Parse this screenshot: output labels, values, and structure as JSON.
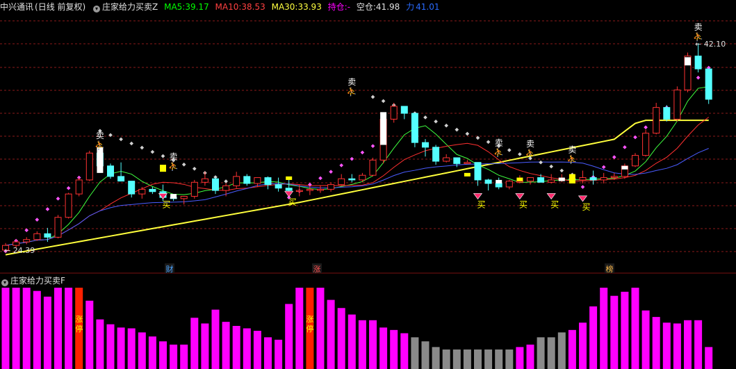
{
  "header": {
    "stock_name": "中兴通讯",
    "period": "(日线 前复权)",
    "indicator_name": "庄家给力买卖Z",
    "ma5_label": "MA5:",
    "ma5_value": "39.17",
    "ma10_label": "MA10:",
    "ma10_value": "38.53",
    "ma30_label": "MA30:",
    "ma30_value": "33.93",
    "position_label": "持仓:",
    "position_value": "-",
    "empty_label": "空仓:",
    "empty_value": "41.98",
    "force_label": "力",
    "force_value": "41.01"
  },
  "sub_header": {
    "indicator_name": "庄家给力买卖F"
  },
  "colors": {
    "up": "#ff3232",
    "down": "#54ffff",
    "ma5": "#ffffff",
    "ma10": "#ffff00",
    "ma30": "#ff00ff",
    "sell_dots": "#cfcfcf",
    "buy_dots": "#ff55ff",
    "base_line": "#ffff3c",
    "hist_magenta": "#ff00ff",
    "hist_gray": "#8a8a8a",
    "hist_red": "#ff2000",
    "grid": "#8b1a1a"
  },
  "price_labels": {
    "high": "42.10",
    "low": "24.39"
  },
  "event_markers": [
    "财",
    "涨",
    "榜"
  ],
  "signal_labels": {
    "buy": "买",
    "sell": "卖",
    "limit_up": "涨停"
  },
  "chart_data": [
    {
      "type": "candlestick",
      "title": "中兴通讯 (日线 前复权)",
      "x": [
        0,
        1,
        2,
        3,
        4,
        5,
        6,
        7,
        8,
        9,
        10,
        11,
        12,
        13,
        14,
        15,
        16,
        17,
        18,
        19,
        20,
        21,
        22,
        23,
        24,
        25,
        26,
        27,
        28,
        29,
        30,
        31,
        32,
        33,
        34,
        35,
        36,
        37,
        38,
        39,
        40,
        41,
        42,
        43,
        44,
        45,
        46,
        47,
        48,
        49,
        50,
        51,
        52,
        53,
        54,
        55,
        56,
        57,
        58,
        59,
        60,
        61,
        62,
        63,
        64,
        65,
        66,
        67
      ],
      "ohlc": [
        [
          24.4,
          25.0,
          24.2,
          24.8
        ],
        [
          24.8,
          25.3,
          24.6,
          25.1
        ],
        [
          25.1,
          25.5,
          24.9,
          25.3
        ],
        [
          25.3,
          26.0,
          25.2,
          25.8
        ],
        [
          25.8,
          26.3,
          25.1,
          25.5
        ],
        [
          25.5,
          27.4,
          25.4,
          27.2
        ],
        [
          27.2,
          29.3,
          27.1,
          29.2
        ],
        [
          29.2,
          30.6,
          29.0,
          30.4
        ],
        [
          30.4,
          32.9,
          30.3,
          32.7
        ],
        [
          32.7,
          32.6,
          31.0,
          31.6
        ],
        [
          31.6,
          31.8,
          30.5,
          30.7
        ],
        [
          30.7,
          31.9,
          30.6,
          30.3
        ],
        [
          30.3,
          29.9,
          28.9,
          29.2
        ],
        [
          29.2,
          29.8,
          28.8,
          29.6
        ],
        [
          29.6,
          29.8,
          29.2,
          29.4
        ],
        [
          29.4,
          30.0,
          28.6,
          28.9
        ],
        [
          28.9,
          29.0,
          28.6,
          28.8
        ],
        [
          28.8,
          29.0,
          28.3,
          29.0
        ],
        [
          29.0,
          30.4,
          28.8,
          30.2
        ],
        [
          30.2,
          31.1,
          29.9,
          30.5
        ],
        [
          30.5,
          30.6,
          29.2,
          29.5
        ],
        [
          29.5,
          30.1,
          29.0,
          29.9
        ],
        [
          29.9,
          31.1,
          29.7,
          30.7
        ],
        [
          30.7,
          30.9,
          29.9,
          30.1
        ],
        [
          30.1,
          30.6,
          29.8,
          30.6
        ],
        [
          30.6,
          30.7,
          29.6,
          30.0
        ],
        [
          30.0,
          30.6,
          29.4,
          29.7
        ],
        [
          29.7,
          30.4,
          29.2,
          29.5
        ],
        [
          29.5,
          30.0,
          29.0,
          29.5
        ],
        [
          29.5,
          29.9,
          29.1,
          29.6
        ],
        [
          29.6,
          29.9,
          29.3,
          29.6
        ],
        [
          29.6,
          30.2,
          29.4,
          30.0
        ],
        [
          30.0,
          30.9,
          29.9,
          30.5
        ],
        [
          30.5,
          30.9,
          30.2,
          30.4
        ],
        [
          30.4,
          31.0,
          30.2,
          30.8
        ],
        [
          30.8,
          32.3,
          30.7,
          32.1
        ],
        [
          32.1,
          35.8,
          31.8,
          35.6
        ],
        [
          35.6,
          37.0,
          35.3,
          36.7
        ],
        [
          36.7,
          36.6,
          35.6,
          36.1
        ],
        [
          36.1,
          35.6,
          33.2,
          33.6
        ],
        [
          33.6,
          33.9,
          32.4,
          33.2
        ],
        [
          33.2,
          33.4,
          31.7,
          32.0
        ],
        [
          32.0,
          32.6,
          31.9,
          32.3
        ],
        [
          32.3,
          32.3,
          31.5,
          31.8
        ],
        [
          31.8,
          32.1,
          31.8,
          31.9
        ],
        [
          31.9,
          31.8,
          29.9,
          30.4
        ],
        [
          30.4,
          30.5,
          29.5,
          30.1
        ],
        [
          30.1,
          30.6,
          29.6,
          29.8
        ],
        [
          29.8,
          30.4,
          29.6,
          30.3
        ],
        [
          30.3,
          30.8,
          30.1,
          30.3
        ],
        [
          30.3,
          30.6,
          30.0,
          30.6
        ],
        [
          30.6,
          30.9,
          30.2,
          30.2
        ],
        [
          30.2,
          30.9,
          30.1,
          30.4
        ],
        [
          30.4,
          30.9,
          30.2,
          30.5
        ],
        [
          30.5,
          30.7,
          30.3,
          30.4
        ],
        [
          30.4,
          31.2,
          30.1,
          30.6
        ],
        [
          30.6,
          31.2,
          30.0,
          30.4
        ],
        [
          30.4,
          31.0,
          30.1,
          30.6
        ],
        [
          30.6,
          31.0,
          30.4,
          30.7
        ],
        [
          30.7,
          31.8,
          30.5,
          31.6
        ],
        [
          31.6,
          32.7,
          31.5,
          32.5
        ],
        [
          32.5,
          34.7,
          32.4,
          34.4
        ],
        [
          34.4,
          37.0,
          34.3,
          36.6
        ],
        [
          36.6,
          36.8,
          35.4,
          35.6
        ],
        [
          35.6,
          38.4,
          35.4,
          38.1
        ],
        [
          38.1,
          41.3,
          37.9,
          41.0
        ],
        [
          41.0,
          42.1,
          39.6,
          39.9
        ],
        [
          39.9,
          39.8,
          36.9,
          37.3
        ]
      ],
      "ma5_last": 39.17,
      "ma10_last": 38.53,
      "ma30_last": 33.93,
      "labels": {
        "high": "42.10",
        "low": "24.39"
      }
    },
    {
      "type": "bar",
      "title": "庄家给力买卖F",
      "x": [
        0,
        1,
        2,
        3,
        4,
        5,
        6,
        7,
        8,
        9,
        10,
        11,
        12,
        13,
        14,
        15,
        16,
        17,
        18,
        19,
        20,
        21,
        22,
        23,
        24,
        25,
        26,
        27,
        28,
        29,
        30,
        31,
        32,
        33,
        34,
        35,
        36,
        37,
        38,
        39,
        40,
        41,
        42,
        43,
        44,
        45,
        46,
        47,
        48,
        49,
        50,
        51,
        52,
        53,
        54,
        55,
        56,
        57,
        58,
        59,
        60,
        61,
        62,
        63,
        64,
        65,
        66,
        67
      ],
      "values": [
        100,
        100,
        100,
        96,
        89,
        100,
        100,
        100,
        84,
        61,
        55,
        51,
        50,
        45,
        40,
        34,
        30,
        30,
        63,
        56,
        73,
        58,
        53,
        50,
        47,
        39,
        36,
        80,
        100,
        100,
        100,
        85,
        75,
        67,
        60,
        60,
        51,
        48,
        44,
        39,
        34,
        27,
        24,
        24,
        24,
        24,
        24,
        24,
        24,
        27,
        30,
        39,
        39,
        45,
        48,
        57,
        77,
        100,
        90,
        95,
        100,
        72,
        64,
        57,
        56,
        60,
        60,
        27
      ],
      "colors": [
        "m",
        "m",
        "m",
        "m",
        "m",
        "m",
        "m",
        "r",
        "m",
        "m",
        "m",
        "m",
        "m",
        "m",
        "m",
        "m",
        "m",
        "m",
        "m",
        "m",
        "m",
        "m",
        "m",
        "m",
        "m",
        "m",
        "m",
        "m",
        "m",
        "r",
        "m",
        "m",
        "m",
        "m",
        "m",
        "m",
        "m",
        "m",
        "m",
        "g",
        "g",
        "g",
        "g",
        "g",
        "g",
        "g",
        "g",
        "g",
        "g",
        "m",
        "m",
        "g",
        "g",
        "g",
        "m",
        "m",
        "m",
        "m",
        "m",
        "m",
        "m",
        "m",
        "m",
        "m",
        "m",
        "m",
        "m",
        "m"
      ],
      "ylim": [
        0,
        100
      ]
    }
  ]
}
